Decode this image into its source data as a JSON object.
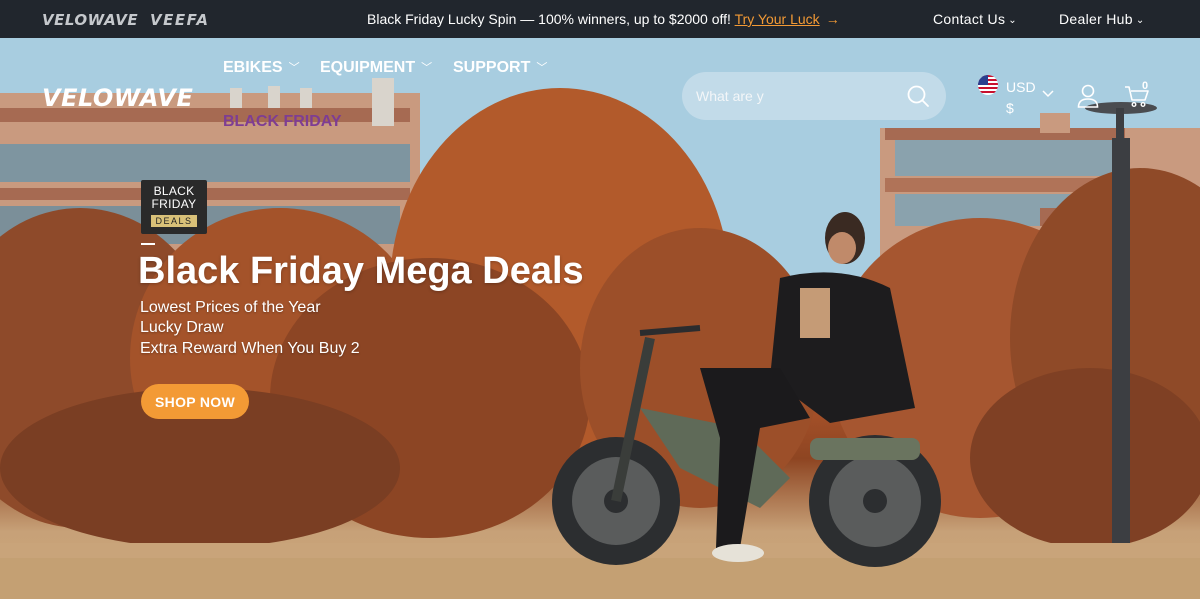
{
  "announcement_bar": {
    "brand_velowave": "VELOWAVE",
    "brand_veefa": "VEEFA",
    "promo_text": "Black Friday Lucky Spin — 100% winners, up to $2000 off!",
    "promo_link": "Try Your Luck",
    "contact_label": "Contact Us",
    "dealer_label": "Dealer Hub"
  },
  "header": {
    "logo": "VELOWAVE",
    "nav": {
      "ebikes": "EBIKES",
      "equipment": "EQUIPMENT",
      "support": "SUPPORT",
      "black_friday": "BLACK FRIDAY"
    },
    "search_placeholder": "What are y",
    "currency": "USD $",
    "cart_count": "0",
    "icons": [
      "search-icon",
      "us-flag-icon",
      "chevron-down-icon",
      "user-icon",
      "cart-icon"
    ]
  },
  "hero": {
    "badge_line1": "BLACK",
    "badge_line2": "FRIDAY",
    "badge_line3": "DEALS",
    "title": "Black Friday Mega Deals",
    "line1": "Lowest Prices of the Year",
    "line2": "Lucky Draw",
    "line3": "Extra Reward When You Buy 2",
    "cta": "SHOP NOW"
  },
  "colors": {
    "accent": "#f39a35",
    "topbar_bg": "#21262d",
    "black_friday_nav": "#7e3d93"
  }
}
